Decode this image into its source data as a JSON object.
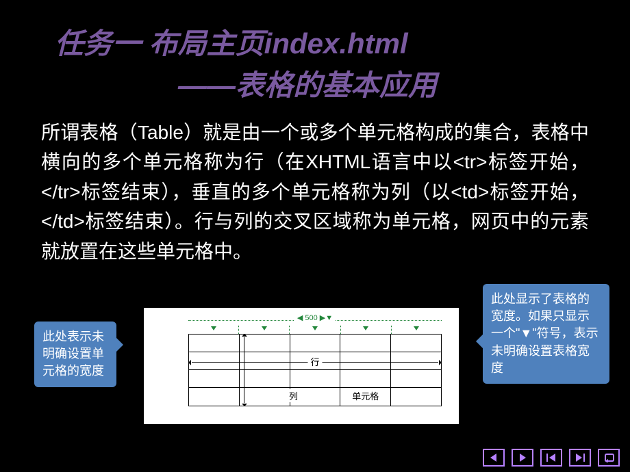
{
  "title": {
    "line1": "任务一  布局主页index.html",
    "line2": "——表格的基本应用"
  },
  "body": "所谓表格（Table）就是由一个或多个单元格构成的集合，表格中横向的多个单元格称为行（在XHTML语言中以<tr>标签开始，</tr>标签结束），垂直的多个单元格称为列（以<td>标签开始，</td>标签结束）。行与列的交叉区域称为单元格，网页中的元素就放置在这些单元格中。",
  "callout_left": "此处表示未明确设置单元格的宽度",
  "callout_right": "此处显示了表格的宽度。如果只显示一个\"▼\"符号，表示未明确设置表格宽度",
  "diagram": {
    "ruler_value": "500",
    "row_label": "行",
    "col_label": "列",
    "cell_label": "单元格"
  },
  "nav": {
    "prev": "◀",
    "next": "▶",
    "first": "⏮",
    "last": "⏭",
    "return": "↩"
  },
  "colors": {
    "title": "#7a5aa0",
    "callout": "#4f81bd",
    "nav": "#b681ff",
    "ruler": "#22863a"
  }
}
